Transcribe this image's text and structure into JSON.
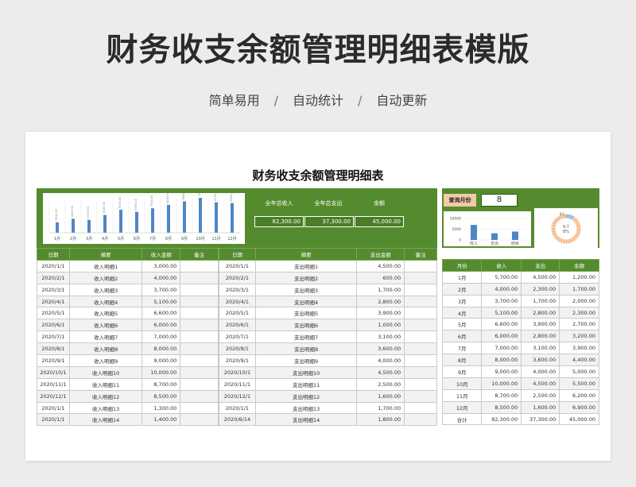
{
  "page": {
    "title": "财务收支余额管理明细表模版",
    "subtitle_items": [
      "简单易用",
      "自动统计",
      "自动更新"
    ],
    "separator": "/"
  },
  "sheet": {
    "title": "财务收支余额管理明细表",
    "summary": {
      "income_label": "全年总收入",
      "income_value": "82,300.00",
      "expense_label": "全年总支出",
      "expense_value": "37,300.00",
      "balance_label": "余额",
      "balance_value": "45,000.00"
    },
    "query": {
      "label": "查询月份",
      "value": "8"
    },
    "colors": {
      "green": "#558b2f",
      "bar_blue": "#4f86c6",
      "donut_orange": "#f0a060",
      "donut_blue": "#9dc3e6",
      "query_bg": "#f4c9a7"
    }
  },
  "chart_data": [
    {
      "type": "bar",
      "categories": [
        "1月",
        "2月",
        "3月",
        "4月",
        "5月",
        "6月",
        "7月",
        "8月",
        "9月",
        "10月",
        "11月",
        "12月"
      ],
      "values": [
        3000,
        4000,
        3700,
        5100,
        6600,
        6000,
        7000,
        8000,
        9000,
        10000,
        8700,
        8500
      ],
      "value_labels": [
        "3000.00",
        "4000.00",
        "3700.00",
        "5100.00",
        "6600.00",
        "6000.00",
        "7000.00",
        "8000.00",
        "9000.00",
        "10000.00",
        "8700.00",
        "8500.00"
      ],
      "ylim": [
        0,
        10000
      ]
    },
    {
      "type": "bar",
      "categories": [
        "收入",
        "支出",
        "结余"
      ],
      "values": [
        7000,
        3100,
        3900
      ],
      "yticks": [
        "10000",
        "5000",
        "0"
      ],
      "ylim": [
        0,
        10000
      ]
    },
    {
      "type": "pie",
      "values": [
        0.097,
        0.903
      ],
      "center_labels": [
        "9.7",
        "8%"
      ],
      "small_label": "8月"
    }
  ],
  "ledger": {
    "income_headers": [
      "日期",
      "摘要",
      "收入金额",
      "备注"
    ],
    "expense_headers": [
      "日期",
      "摘要",
      "支出金额",
      "备注"
    ],
    "income_rows": [
      [
        "2020/1/1",
        "收入明细1",
        "3,000.00",
        ""
      ],
      [
        "2020/2/1",
        "收入明细2",
        "4,000.00",
        ""
      ],
      [
        "2020/3/1",
        "收入明细3",
        "3,700.00",
        ""
      ],
      [
        "2020/4/1",
        "收入明细4",
        "5,100.00",
        ""
      ],
      [
        "2020/5/1",
        "收入明细5",
        "6,600.00",
        ""
      ],
      [
        "2020/6/1",
        "收入明细6",
        "6,000.00",
        ""
      ],
      [
        "2020/7/1",
        "收入明细7",
        "7,000.00",
        ""
      ],
      [
        "2020/8/1",
        "收入明细8",
        "8,000.00",
        ""
      ],
      [
        "2020/9/1",
        "收入明细9",
        "9,000.00",
        ""
      ],
      [
        "2020/10/1",
        "收入明细10",
        "10,000.00",
        ""
      ],
      [
        "2020/11/1",
        "收入明细11",
        "8,700.00",
        ""
      ],
      [
        "2020/12/1",
        "收入明细12",
        "8,500.00",
        ""
      ],
      [
        "2020/1/1",
        "收入明细13",
        "1,300.00",
        ""
      ],
      [
        "2020/1/1",
        "收入明细14",
        "1,400.00",
        ""
      ]
    ],
    "expense_rows": [
      [
        "2020/1/1",
        "支出明细1",
        "4,500.00",
        ""
      ],
      [
        "2020/2/1",
        "支出明细2",
        "600.00",
        ""
      ],
      [
        "2020/3/1",
        "支出明细3",
        "1,700.00",
        ""
      ],
      [
        "2020/4/1",
        "支出明细4",
        "2,800.00",
        ""
      ],
      [
        "2020/5/1",
        "支出明细5",
        "3,900.00",
        ""
      ],
      [
        "2020/6/1",
        "支出明细6",
        "1,000.00",
        ""
      ],
      [
        "2020/7/1",
        "支出明细7",
        "3,100.00",
        ""
      ],
      [
        "2020/8/1",
        "支出明细8",
        "3,600.00",
        ""
      ],
      [
        "2020/9/1",
        "支出明细9",
        "4,000.00",
        ""
      ],
      [
        "2020/10/1",
        "支出明细10",
        "4,500.00",
        ""
      ],
      [
        "2020/11/1",
        "支出明细11",
        "2,500.00",
        ""
      ],
      [
        "2020/12/1",
        "支出明细12",
        "1,600.00",
        ""
      ],
      [
        "2020/1/1",
        "支出明细13",
        "1,700.00",
        ""
      ],
      [
        "2020/6/14",
        "支出明细14",
        "1,800.00",
        ""
      ]
    ]
  },
  "monthly": {
    "headers": [
      "月份",
      "收入",
      "支出",
      "余额"
    ],
    "rows": [
      [
        "1月",
        "5,700.00",
        "4,500.00",
        "1,200.00"
      ],
      [
        "2月",
        "4,000.00",
        "2,300.00",
        "1,700.00"
      ],
      [
        "3月",
        "3,700.00",
        "1,700.00",
        "2,000.00"
      ],
      [
        "4月",
        "5,100.00",
        "2,800.00",
        "2,300.00"
      ],
      [
        "5月",
        "6,600.00",
        "3,900.00",
        "2,700.00"
      ],
      [
        "6月",
        "6,000.00",
        "2,800.00",
        "3,200.00"
      ],
      [
        "7月",
        "7,000.00",
        "3,100.00",
        "3,900.00"
      ],
      [
        "8月",
        "8,000.00",
        "3,600.00",
        "4,400.00"
      ],
      [
        "9月",
        "9,000.00",
        "4,000.00",
        "5,000.00"
      ],
      [
        "10月",
        "10,000.00",
        "4,500.00",
        "5,500.00"
      ],
      [
        "11月",
        "8,700.00",
        "2,500.00",
        "6,200.00"
      ],
      [
        "12月",
        "8,500.00",
        "1,600.00",
        "6,900.00"
      ],
      [
        "合计",
        "82,300.00",
        "37,300.00",
        "45,000.00"
      ]
    ]
  }
}
